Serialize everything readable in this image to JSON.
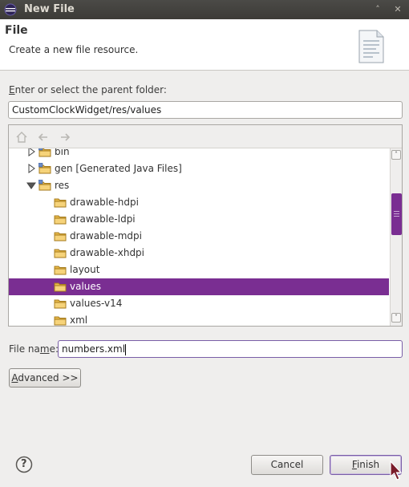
{
  "window": {
    "title": "New File",
    "minimize_glyph": "˄",
    "close_glyph": "✕"
  },
  "header": {
    "title": "File",
    "description": "Create a new file resource."
  },
  "parent_folder": {
    "label_mnemonic": "E",
    "label_rest": "nter or select the parent folder:",
    "value": "CustomClockWidget/res/values"
  },
  "tree": {
    "rows": [
      {
        "label": "bin",
        "indent": 1,
        "toggle": "collapsed",
        "partial": true
      },
      {
        "label": "gen [Generated Java Files]",
        "indent": 1,
        "toggle": "collapsed"
      },
      {
        "label": "res",
        "indent": 1,
        "toggle": "expanded"
      },
      {
        "label": "drawable-hdpi",
        "indent": 2
      },
      {
        "label": "drawable-ldpi",
        "indent": 2
      },
      {
        "label": "drawable-mdpi",
        "indent": 2
      },
      {
        "label": "drawable-xhdpi",
        "indent": 2
      },
      {
        "label": "layout",
        "indent": 2
      },
      {
        "label": "values",
        "indent": 2,
        "selected": true
      },
      {
        "label": "values-v14",
        "indent": 2
      },
      {
        "label": "xml",
        "indent": 2
      }
    ],
    "scrollbar": {
      "up_arrow": "˄",
      "down_arrow": "˅"
    }
  },
  "file_name": {
    "label_mnemonic": "m",
    "label_before": "File na",
    "label_after": "e:",
    "value": "numbers.xml"
  },
  "buttons": {
    "advanced_mnemonic": "A",
    "advanced_rest": "dvanced >>",
    "cancel": "Cancel",
    "finish_mnemonic": "F",
    "finish_rest": "inish"
  },
  "help": {
    "glyph": "?"
  },
  "colors": {
    "selection": "#7a2e92",
    "focus_border": "#7a5ea7",
    "folder": "#e9b94a"
  }
}
